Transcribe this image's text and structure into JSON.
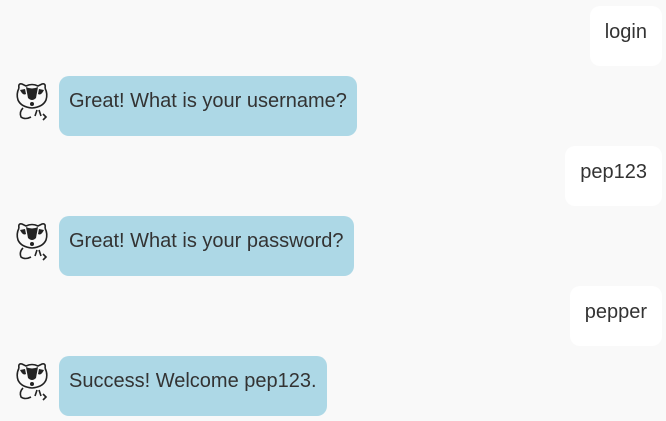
{
  "messages": [
    {
      "sender": "user",
      "text": "login"
    },
    {
      "sender": "bot",
      "text": "Great! What is your username?",
      "avatar_icon": "badger-icon"
    },
    {
      "sender": "user",
      "text": "pep123"
    },
    {
      "sender": "bot",
      "text": "Great! What is your password?",
      "avatar_icon": "badger-icon"
    },
    {
      "sender": "user",
      "text": "pepper"
    },
    {
      "sender": "bot",
      "text": "Success! Welcome pep123.",
      "avatar_icon": "badger-icon"
    }
  ],
  "colors": {
    "background": "#f9f9f9",
    "bot_bubble": "#add8e6",
    "user_bubble": "#ffffff",
    "text": "#333333"
  }
}
